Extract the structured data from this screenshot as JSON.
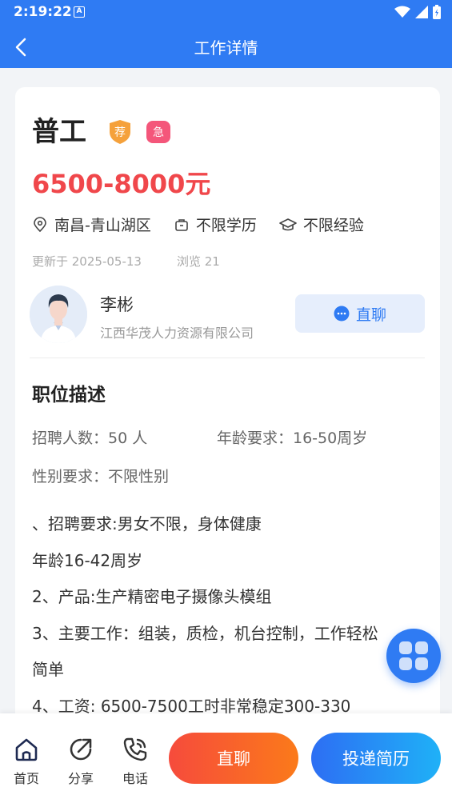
{
  "status_bar": {
    "time": "2:19:22",
    "notification_icon": "a-icon",
    "icons": [
      "wifi-icon",
      "signal-icon",
      "battery-icon"
    ]
  },
  "nav": {
    "title": "工作详情",
    "back_icon": "back-arrow-icon"
  },
  "job": {
    "title": "普工",
    "badge_recommend": "荐",
    "badge_urgent": "急",
    "salary": "6500-8000元",
    "location": "南昌-青山湖区",
    "education": "不限学历",
    "experience": "不限经验",
    "updated": "更新于 2025-05-13",
    "views": "浏览 21"
  },
  "recruiter": {
    "name": "李彬",
    "company": "江西华茂人力资源有限公司",
    "chat_label": "直聊"
  },
  "description": {
    "section_title": "职位描述",
    "headcount": "招聘人数：50 人",
    "age": "年龄要求：16-50周岁",
    "gender": "性别要求：不限性别",
    "lines": [
      "、招聘要求:男女不限，身体健康",
      "年龄16-42周岁",
      "2、产品:生产精密电子摄像头模组",
      "3、主要工作：组装，质检，机台控制，工作轻松",
      "简单",
      "4、工资: 6500-7500工时非常稳定300-330"
    ]
  },
  "bottom_bar": {
    "home": "首页",
    "share": "分享",
    "phone": "电话",
    "chat": "直聊",
    "apply": "投递简历"
  },
  "colors": {
    "primary": "#2f7bf3",
    "salary": "#f0474b",
    "badge_recommend": "#f5a13b",
    "badge_urgent": "#f4567a"
  }
}
